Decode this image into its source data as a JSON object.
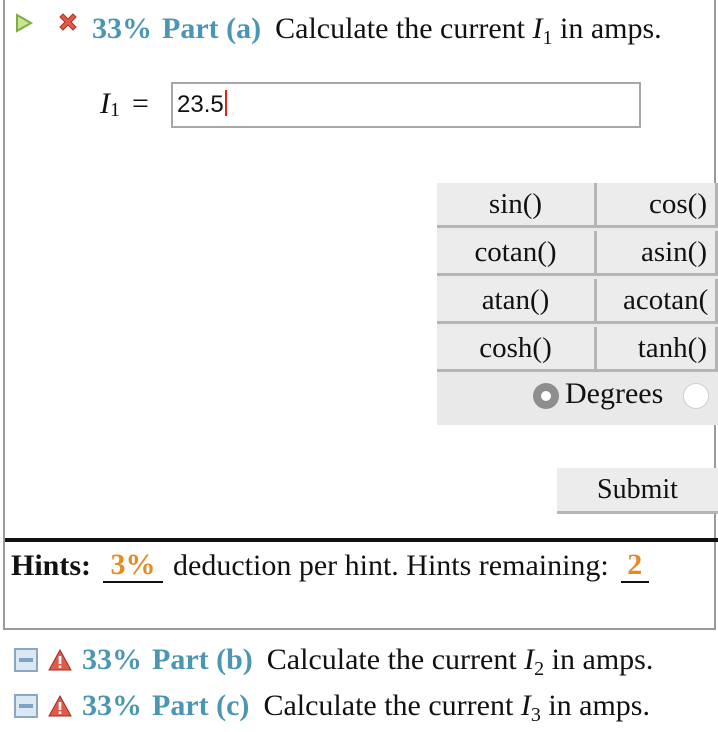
{
  "part_a": {
    "percent": "33%",
    "part_label": "Part (a)",
    "question_prefix": "Calculate the current ",
    "variable": "I",
    "subscript": "1",
    "question_suffix": " in amps.",
    "equation_variable": "I",
    "equation_subscript": "1",
    "equals": "=",
    "answer_value": "23.5"
  },
  "keypad": {
    "keys": [
      "sin()",
      "cos()",
      "cotan()",
      "asin()",
      "atan()",
      "acotan(",
      "cosh()",
      "tanh()"
    ],
    "degrees_label": "Degrees",
    "degrees_selected": true
  },
  "submit_label": "Submit",
  "hints": {
    "title": "Hints:",
    "deduction_value": "3%",
    "deduction_text": "deduction per hint. Hints remaining:",
    "remaining": "2"
  },
  "other_parts": [
    {
      "percent": "33%",
      "part_label": "Part (b)",
      "question_prefix": "Calculate the current ",
      "variable": "I",
      "subscript": "2",
      "question_suffix": " in amps."
    },
    {
      "percent": "33%",
      "part_label": "Part (c)",
      "question_prefix": "Calculate the current ",
      "variable": "I",
      "subscript": "3",
      "question_suffix": " in amps."
    }
  ],
  "colors": {
    "accent": "#4b97b3",
    "hint": "#e58b22",
    "warning": "#d63b2a",
    "caret": "#e0241a"
  }
}
